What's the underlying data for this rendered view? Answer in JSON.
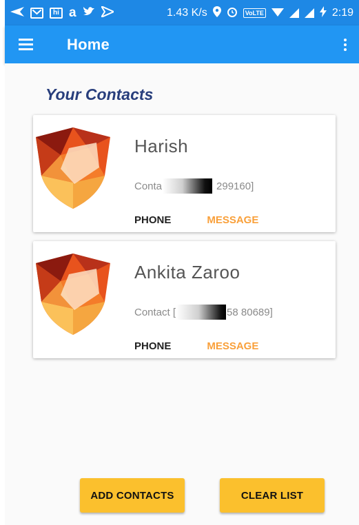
{
  "status_bar": {
    "network_speed": "1.43 K/s",
    "volte_label": "VoLTE",
    "time": "2:19",
    "icons": [
      "send-icon",
      "gmail-icon",
      "hike-icon",
      "amazon-icon",
      "twitter-icon",
      "flipboard-icon",
      "location-icon",
      "alarm-icon",
      "volte-icon",
      "wifi-icon",
      "signal-icon",
      "signal-icon",
      "charging-icon"
    ]
  },
  "app_bar": {
    "title": "Home",
    "menu_icon": "hamburger-menu-icon",
    "overflow_icon": "more-vert-icon",
    "color": "#2196f3"
  },
  "main": {
    "section_title": "Your Contacts",
    "contacts": [
      {
        "name": "Harish",
        "number_prefix": "Conta",
        "number_suffix": "299160]",
        "phone_label": "PHONE",
        "message_label": "MESSAGE"
      },
      {
        "name": "Ankita Zaroo",
        "number_prefix": "Contact [",
        "number_suffix": "58 80689]",
        "phone_label": "PHONE",
        "message_label": "MESSAGE"
      }
    ]
  },
  "footer": {
    "add_contacts_label": "ADD CONTACTS",
    "clear_list_label": "CLEAR LIST",
    "button_color": "#fbc02d"
  },
  "colors": {
    "status_bar": "#1e88e5",
    "title_text": "#283e7c",
    "message_accent": "#f9a03a"
  }
}
